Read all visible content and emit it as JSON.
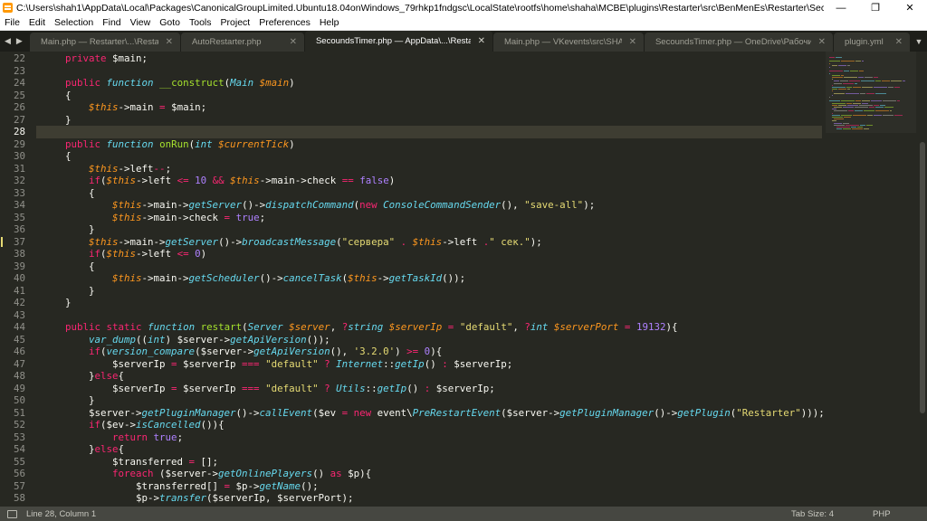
{
  "window": {
    "title": "C:\\Users\\shah1\\AppData\\Local\\Packages\\CanonicalGroupLimited.Ubuntu18.04onWindows_79rhkp1fndgsc\\LocalState\\rootfs\\home\\shaha\\MCBE\\plugins\\Restarter\\src\\BenMenEs\\Restarter\\SecoundsTimer.php - Sublime Text (..."
  },
  "controls": {
    "minimize": "—",
    "restore": "❐",
    "close": "✕"
  },
  "menu": [
    "File",
    "Edit",
    "Selection",
    "Find",
    "View",
    "Goto",
    "Tools",
    "Project",
    "Preferences",
    "Help"
  ],
  "tabs": [
    {
      "label": "Main.php — Restarter\\...\\Restarter",
      "active": false
    },
    {
      "label": "AutoRestarter.php",
      "active": false
    },
    {
      "label": "SecoundsTimer.php — AppData\\...\\Restarter",
      "active": true
    },
    {
      "label": "Main.php — VKevents\\src\\SHAHA",
      "active": false
    },
    {
      "label": "SecoundsTimer.php — OneDrive\\Рабочий стол",
      "active": false
    },
    {
      "label": "plugin.yml",
      "active": false
    }
  ],
  "editor": {
    "current_line": 28,
    "modified_lines": [
      37
    ],
    "lines": [
      {
        "n": 22,
        "code": "    <k>private</k> $main;"
      },
      {
        "n": 23,
        "code": ""
      },
      {
        "n": 24,
        "code": "    <k>public</k> <f>function</f> <n>__construct</n>(<cls>Main</cls> <v>$main</v>)"
      },
      {
        "n": 25,
        "code": "    {"
      },
      {
        "n": 26,
        "code": "        <v>$this</v>->main <k>=</k> $main;"
      },
      {
        "n": 27,
        "code": "    }"
      },
      {
        "n": 28,
        "code": ""
      },
      {
        "n": 29,
        "code": "    <k>public</k> <f>function</f> <n>onRun</n>(<f>int</f> <v>$currentTick</v>)"
      },
      {
        "n": 30,
        "code": "    {"
      },
      {
        "n": 31,
        "code": "        <v>$this</v>->left<k>--</k>;"
      },
      {
        "n": 32,
        "code": "        <k>if</k>(<v>$this</v>->left <k><=</k> <c>10</c> <k>&&</k> <v>$this</v>->main->check <k>==</k> <c>false</c>)"
      },
      {
        "n": 33,
        "code": "        {"
      },
      {
        "n": 34,
        "code": "            <v>$this</v>->main-><f>getServer</f>()-><f>dispatchCommand</f>(<k>new</k> <cls>ConsoleCommandSender</cls>(), <s>\"save-all\"</s>);"
      },
      {
        "n": 35,
        "code": "            <v>$this</v>->main->check <k>=</k> <c>true</c>;"
      },
      {
        "n": 36,
        "code": "        }"
      },
      {
        "n": 37,
        "code": "        <v>$this</v>->main-><f>getServer</f>()-><f>broadcastMessage</f>(<s>\"сервера\"</s> <k>.</k> <v>$this</v>->left <k>.</k><s>\" сек.\"</s>);"
      },
      {
        "n": 38,
        "code": "        <k>if</k>(<v>$this</v>->left <k><=</k> <c>0</c>)"
      },
      {
        "n": 39,
        "code": "        {"
      },
      {
        "n": 40,
        "code": "            <v>$this</v>->main-><f>getScheduler</f>()-><f>cancelTask</f>(<v>$this</v>-><f>getTaskId</f>());"
      },
      {
        "n": 41,
        "code": "        }"
      },
      {
        "n": 42,
        "code": "    }"
      },
      {
        "n": 43,
        "code": ""
      },
      {
        "n": 44,
        "code": "    <k>public</k> <k>static</k> <f>function</f> <n>restart</n>(<cls>Server</cls> <v>$server</v>, <k>?</k><f>string</f> <v>$serverIp</v> <k>=</k> <s>\"default\"</s>, <k>?</k><f>int</f> <v>$serverPort</v> <k>=</k> <c>19132</c>){"
      },
      {
        "n": 45,
        "code": "        <f>var_dump</f>((<f>int</f>) $server-><f>getApiVersion</f>());"
      },
      {
        "n": 46,
        "code": "        <k>if</k>(<f>version_compare</f>($server-><f>getApiVersion</f>(), <s>'3.2.0'</s>) <k>>=</k> <c>0</c>){"
      },
      {
        "n": 47,
        "code": "            $serverIp <k>=</k> $serverIp <k>===</k> <s>\"default\"</s> <k>?</k> <cls>Internet</cls>::<f>getIp</f>() <k>:</k> $serverIp;"
      },
      {
        "n": 48,
        "code": "        }<k>else</k>{"
      },
      {
        "n": 49,
        "code": "            $serverIp <k>=</k> $serverIp <k>===</k> <s>\"default\"</s> <k>?</k> <cls>Utils</cls>::<f>getIp</f>() <k>:</k> $serverIp;"
      },
      {
        "n": 50,
        "code": "        }"
      },
      {
        "n": 51,
        "code": "        $server-><f>getPluginManager</f>()-><f>callEvent</f>($ev <k>=</k> <k>new</k> event\\<cls>PreRestartEvent</cls>($server-><f>getPluginManager</f>()-><f>getPlugin</f>(<s>\"Restarter\"</s>)));"
      },
      {
        "n": 52,
        "code": "        <k>if</k>($ev-><f>isCancelled</f>()){"
      },
      {
        "n": 53,
        "code": "            <k>return</k> <c>true</c>;"
      },
      {
        "n": 54,
        "code": "        }<k>else</k>{"
      },
      {
        "n": 55,
        "code": "            $transferred <k>=</k> [];"
      },
      {
        "n": 56,
        "code": "            <k>foreach</k> ($server-><f>getOnlinePlayers</f>() <k>as</k> $p){"
      },
      {
        "n": 57,
        "code": "                $transferred[] <k>=</k> $p-><f>getName</f>();"
      },
      {
        "n": 58,
        "code": "                $p-><f>transfer</f>($serverIp, $serverPort);"
      }
    ]
  },
  "status": {
    "position": "Line 28, Column 1",
    "tab_size": "Tab Size: 4",
    "syntax": "PHP"
  },
  "colors": {
    "background": "#272822",
    "keyword": "#f92672",
    "function": "#66d9ef",
    "name": "#a6e22e",
    "variable": "#fd971f",
    "string": "#e6db74",
    "constant": "#ae81ff"
  },
  "icons": {
    "app": "sublime-text-icon",
    "nav_left": "chevron-left-icon",
    "nav_right": "chevron-right-icon",
    "tab_close": "close-icon",
    "tab_dropdown": "chevron-down-icon",
    "status_panel": "panel-toggle-icon"
  }
}
